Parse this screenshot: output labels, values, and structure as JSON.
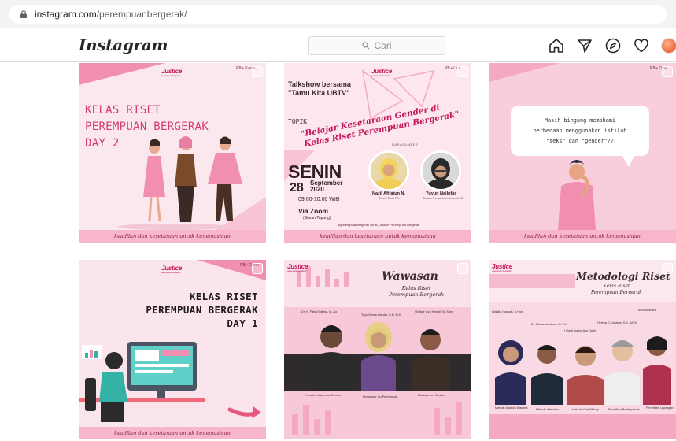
{
  "browser": {
    "url_host": "instagram.com",
    "url_path": "/perempuanbergerak/"
  },
  "header": {
    "logo": "Instagram",
    "search_placeholder": "Cari",
    "nav_icons": [
      "home-icon",
      "direct-message-icon",
      "explore-icon",
      "activity-heart-icon",
      "profile-avatar"
    ]
  },
  "colors": {
    "accent_pink": "#d63b72",
    "footer_pink": "#f7b6cc",
    "brand_magenta": "#c2185b"
  },
  "posts": [
    {
      "brand": "Justice",
      "tag": "PB • Event",
      "title_lines": [
        "KELAS RISET",
        "PEREMPUAN BERGERAK",
        "DAY 2"
      ],
      "footer": "keadilan dan kesetaraan untuk kemanusiaan"
    },
    {
      "brand": "Justice",
      "tag": "PB • Live",
      "talkshow": "Talkshow bersama",
      "guest": "\"Tamu Kita UBTV\"",
      "topik_label": "TOPIK",
      "topic_line1": "\"Belajar Kesetaraan Gender di",
      "topic_line2": "Kelas Riset Perempuan Bergerak\"",
      "narasumber_label": "NARASUMBER",
      "day": "SENIN",
      "date": "28",
      "month": "September",
      "year": "2020",
      "time": "09.00-10.00 WIB",
      "via": "Via Zoom",
      "siaran": "(Siaran Tapong)",
      "speakers": [
        {
          "name": "Nazil Afifatun N.",
          "role": "Devisi Riset PB"
        },
        {
          "name": "Yuyun Nailufar",
          "role": "Dewan Penasehat Nasional PB"
        }
      ],
      "socials": "@perempuanbergerak   @PB_Justice   Perempuan Bergerak",
      "footer": "keadilan dan kesetaraan untuk kemanusiaan"
    },
    {
      "tag": "PB • Daily",
      "bubble_lines": [
        "Masih bingung memahami",
        "perbedaan menggunakan istilah",
        "\"seks\" dan \"gender\"??"
      ],
      "footer": "keadilan dan kesetaraan untuk kemanusiaan"
    },
    {
      "brand": "Justice",
      "tag": "PB • Event",
      "title_lines": [
        "KELAS RISET",
        "PEREMPUAN BERGERAK",
        "DAY 1"
      ],
      "footer": "keadilan dan kesetaraan untuk kemanusiaan"
    },
    {
      "brand": "Justice",
      "title": "Wawasan",
      "subtitle_lines": [
        "Kelas Riset",
        "Perempuan Bergerak"
      ],
      "names": [
        "Dr. H. Faisol Fatawi, M. Ag",
        "Tuyu Dhora Hafufar, S.H, M.H",
        "Shofwe Ikva Hamdi, Ira Sam"
      ],
      "roles": [
        "Pemateri Islam dan Gender",
        "Pengantar Isu Perempuan",
        "Narasumber Gender"
      ]
    },
    {
      "brand": "Justice",
      "title": "Metodologi Riset",
      "subtitle_lines": [
        "Kelas Riset",
        "Perempuan Bergerak"
      ],
      "names": [
        "Wabilla Hasnah, S.Hum.",
        "Dr. Mohamad Anas, M. Phil",
        "Helena D. Justicia, S.S., M.Si",
        "Beni Andriani",
        "I Gusti Agung Ayu Ratih"
      ],
      "roles": [
        "Metode Analisis Wacana",
        "Metode Interview",
        "Metode Oral History",
        "Penelitian Partisipatoris",
        "Penelitian Lapangan"
      ]
    }
  ]
}
